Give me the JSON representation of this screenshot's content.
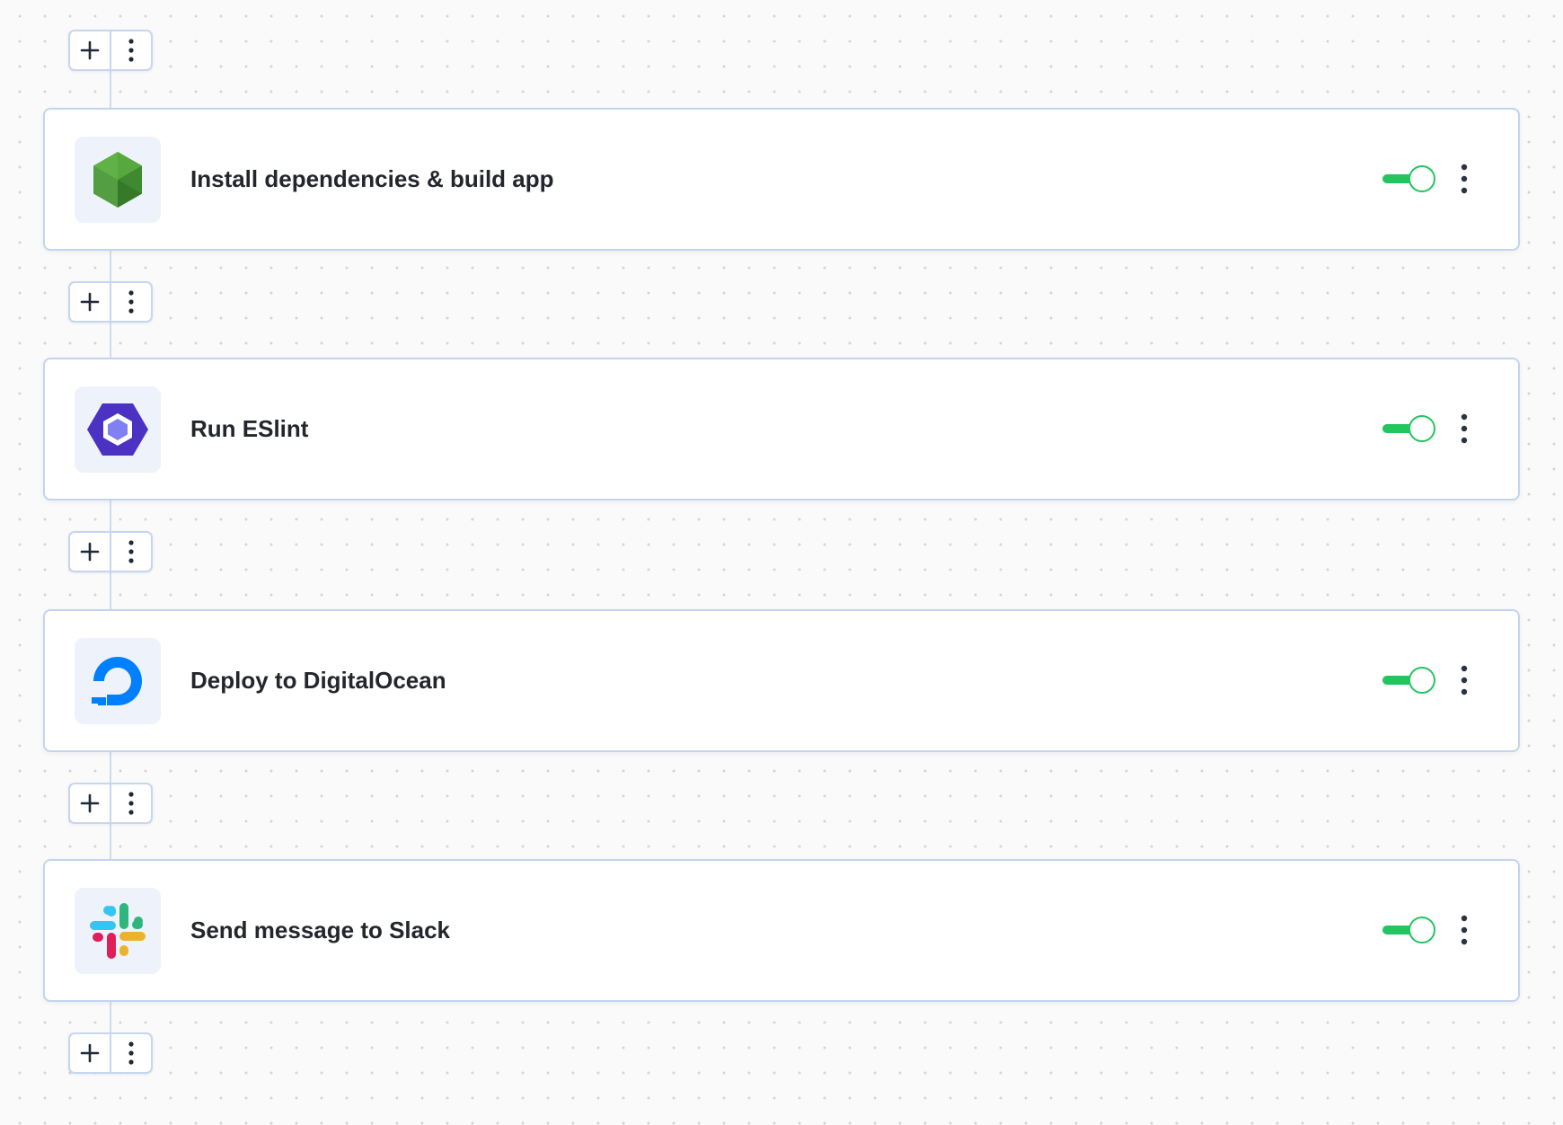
{
  "workflow": {
    "accent_color": "#22c55e",
    "steps": [
      {
        "title": "Install dependencies & build app",
        "icon": "nodejs-icon",
        "enabled": true
      },
      {
        "title": "Run ESlint",
        "icon": "eslint-icon",
        "enabled": true
      },
      {
        "title": "Deploy to DigitalOcean",
        "icon": "digitalocean-icon",
        "enabled": true
      },
      {
        "title": "Send message to Slack",
        "icon": "slack-icon",
        "enabled": true
      }
    ]
  }
}
